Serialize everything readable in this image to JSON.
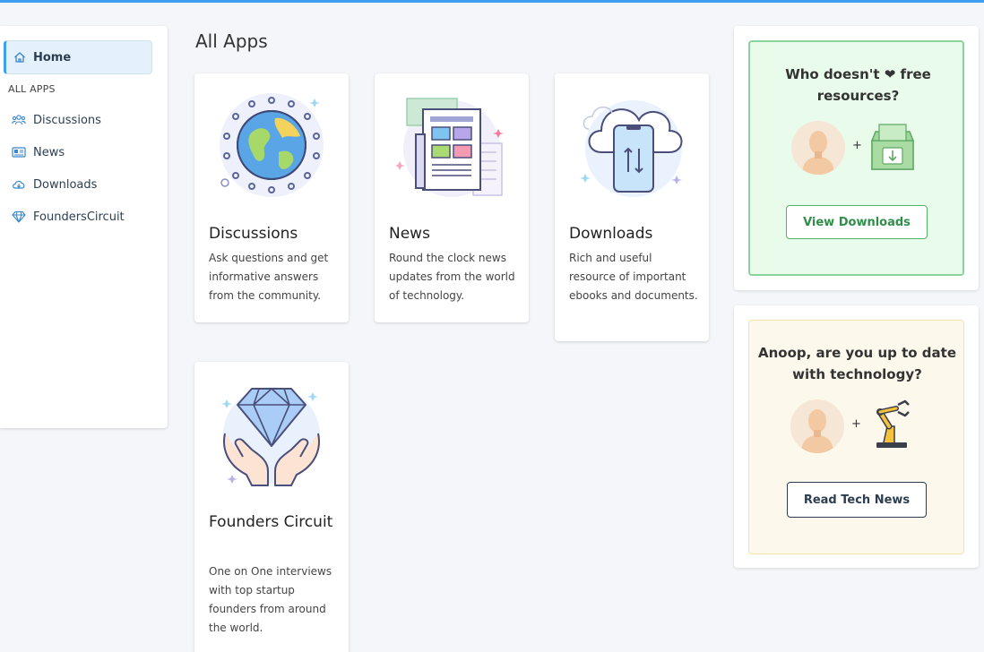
{
  "sidebar": {
    "home_label": "Home",
    "section_label": "ALL APPS",
    "items": [
      {
        "label": "Discussions",
        "icon": "users-icon"
      },
      {
        "label": "News",
        "icon": "newspaper-icon"
      },
      {
        "label": "Downloads",
        "icon": "cloud-download-icon"
      },
      {
        "label": "FoundersCircuit",
        "icon": "diamond-icon"
      }
    ]
  },
  "main": {
    "title": "All Apps",
    "cards": [
      {
        "title": "Discussions",
        "description": "Ask questions and get informative answers from the community."
      },
      {
        "title": "News",
        "description": "Round the clock news updates from the world of technology."
      },
      {
        "title": "Downloads",
        "description": "Rich and useful resource of important ebooks and documents."
      },
      {
        "title": "Founders Circuit",
        "description": "One on One interviews with top startup founders from around the world."
      }
    ]
  },
  "promos": [
    {
      "title": "Who doesn't ❤ free resources?",
      "plus": "+",
      "button": "View Downloads"
    },
    {
      "title": "Anoop, are you up to date with technology?",
      "plus": "+",
      "button": "Read Tech News"
    }
  ],
  "colors": {
    "accent": "#3fa0f2",
    "green": "#52b36a",
    "navy": "#2d3e50"
  }
}
